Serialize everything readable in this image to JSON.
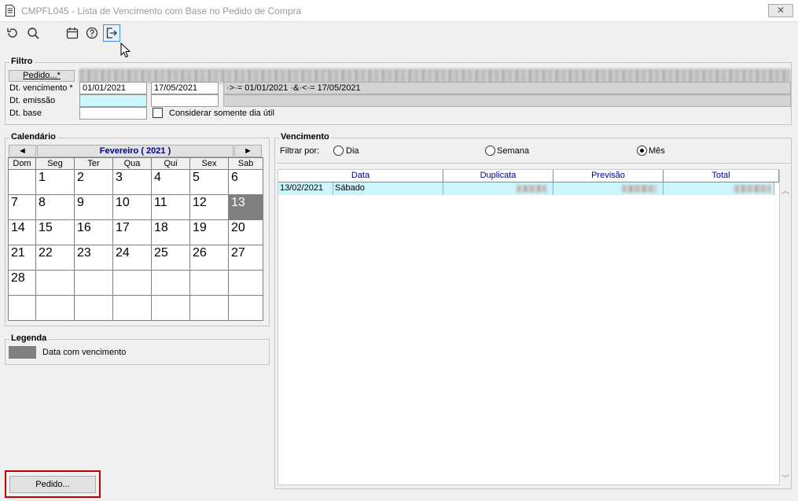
{
  "window": {
    "title": "CMPFL045 - Lista de Vencimento com Base no Pedido de Compra",
    "close_label": "✕"
  },
  "toolbar": {
    "buttons": [
      "refresh-icon",
      "search-icon",
      "calendar-icon",
      "help-icon",
      "exit-icon"
    ]
  },
  "filtro": {
    "title": "Filtro",
    "pedido_button": "Pedido...*",
    "dt_vencimento_label": "Dt. vencimento *",
    "dt_vencimento_from": "01/01/2021",
    "dt_vencimento_to": "17/05/2021",
    "dt_vencimento_expr": "·>·= 01/01/2021 ·&·<·= 17/05/2021",
    "dt_emissao_label": "Dt. emissão",
    "dt_base_label": "Dt. base",
    "dia_util_label": "Considerar somente dia útil"
  },
  "calendario": {
    "title": "Calendário",
    "prev": "◄",
    "next": "►",
    "month": "Fevereiro ( 2021 )",
    "weekdays": [
      "Dom",
      "Seg",
      "Ter",
      "Qua",
      "Qui",
      "Sex",
      "Sab"
    ],
    "weeks": [
      [
        "",
        "1",
        "2",
        "3",
        "4",
        "5",
        "6"
      ],
      [
        "7",
        "8",
        "9",
        "10",
        "11",
        "12",
        "13"
      ],
      [
        "14",
        "15",
        "16",
        "17",
        "18",
        "19",
        "20"
      ],
      [
        "21",
        "22",
        "23",
        "24",
        "25",
        "26",
        "27"
      ],
      [
        "28",
        "",
        "",
        "",
        "",
        "",
        ""
      ],
      [
        "",
        "",
        "",
        "",
        "",
        "",
        ""
      ]
    ],
    "marked_days": [
      "13"
    ]
  },
  "legenda": {
    "title": "Legenda",
    "item": "Data com vencimento"
  },
  "vencimento": {
    "title": "Vencimento",
    "filter_label": "Filtrar por:",
    "options": [
      "Dia",
      "Semana",
      "Mês"
    ],
    "selected": "Mês",
    "columns": [
      "Data",
      "Duplicata",
      "Previsão",
      "Total"
    ],
    "rows": [
      {
        "date": "13/02/2021",
        "weekday": "Sábado"
      }
    ]
  },
  "footer": {
    "pedido_button": "Pedido..."
  },
  "colors": {
    "marked": "#808080",
    "row_highlight": "#ccf5fd",
    "header_text": "#00008b",
    "focus_border": "#c00000"
  }
}
